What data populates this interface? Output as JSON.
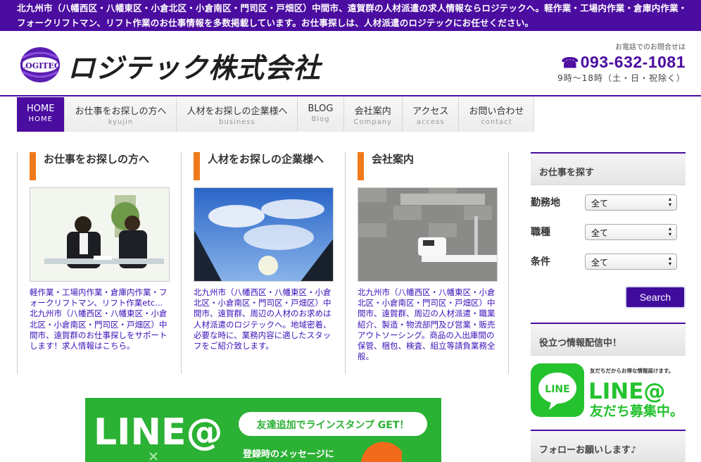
{
  "topbar": {
    "text": "北九州市（八幡西区・八幡東区・小倉北区・小倉南区・門司区・戸畑区）中間市、遠賀群の人材派遣の求人情報ならロジテックへ。軽作業・工場内作業・倉庫内作業・フォークリフトマン、リフト作業のお仕事情報を多数掲載しています。お仕事探しは、人材派遣のロジテックにお任せください。"
  },
  "header": {
    "logo_mark_text": "LOGITEC",
    "company_name": "ロジテック株式会社",
    "tel_note": "お電話でのお問合せは",
    "tel_number": "093-632-1081",
    "tel_hours": "9時〜18時（土・日・祝除く）"
  },
  "nav": [
    {
      "label": "HOME",
      "sub": "HOME"
    },
    {
      "label": "お仕事をお探しの方へ",
      "sub": "kyujin"
    },
    {
      "label": "人材をお探しの企業様へ",
      "sub": "business"
    },
    {
      "label": "BLOG",
      "sub": "Blog"
    },
    {
      "label": "会社案内",
      "sub": "Company"
    },
    {
      "label": "アクセス",
      "sub": "access"
    },
    {
      "label": "お問い合わせ",
      "sub": "contact"
    }
  ],
  "columns": [
    {
      "title": "お仕事をお探しの方へ",
      "text": "軽作業・工場内作業・倉庫内作業・フォークリフトマン、リフト作業etc...北九州市（八幡西区・八幡東区・小倉北区・小倉南区・門司区・戸畑区）中間市、遠賀群のお仕事探しをサポートします！求人情報はこちら。"
    },
    {
      "title": "人材をお探しの企業様へ",
      "text": "北九州市（八幡西区・八幡東区・小倉北区・小倉南区・門司区・戸畑区）中間市、遠賀群、周辺の人材のお求めは人材派遣のロジテックへ。地域密着、必要な時に、業務内容に適したスタッフをご紹介致します。"
    },
    {
      "title": "会社案内",
      "text": "北九州市（八幡西区・八幡東区・小倉北区・小倉南区・門司区・戸畑区）中間市、遠賀群、周辺の人材派遣・職業紹介、製造・物流部門及び営業・販売アウトソーシング。商品の入出庫間の保管、梱包、検査、組立等請負業務全般。"
    }
  ],
  "sidebar": {
    "search_heading": "お仕事を探す",
    "fields": [
      {
        "label": "勤務地",
        "value": "全て"
      },
      {
        "label": "職種",
        "value": "全て"
      },
      {
        "label": "条件",
        "value": "全て"
      }
    ],
    "search_button": "Search",
    "info_heading": "役立つ情報配信中！",
    "line_small": "友だちだからお得な情報届けます。",
    "line_title": "LINE@",
    "line_sub": "友だち募集中。",
    "follow_heading": "フォローお願いします♪"
  },
  "banner": {
    "title": "LINE@",
    "badge": "友達追加でラインスタンプ GET！",
    "sub": "登録時のメッセージに"
  },
  "colors": {
    "brand": "#4b0ca0",
    "accent": "#f07a1a",
    "link": "#3a10b8",
    "line_green": "#2bb134"
  }
}
